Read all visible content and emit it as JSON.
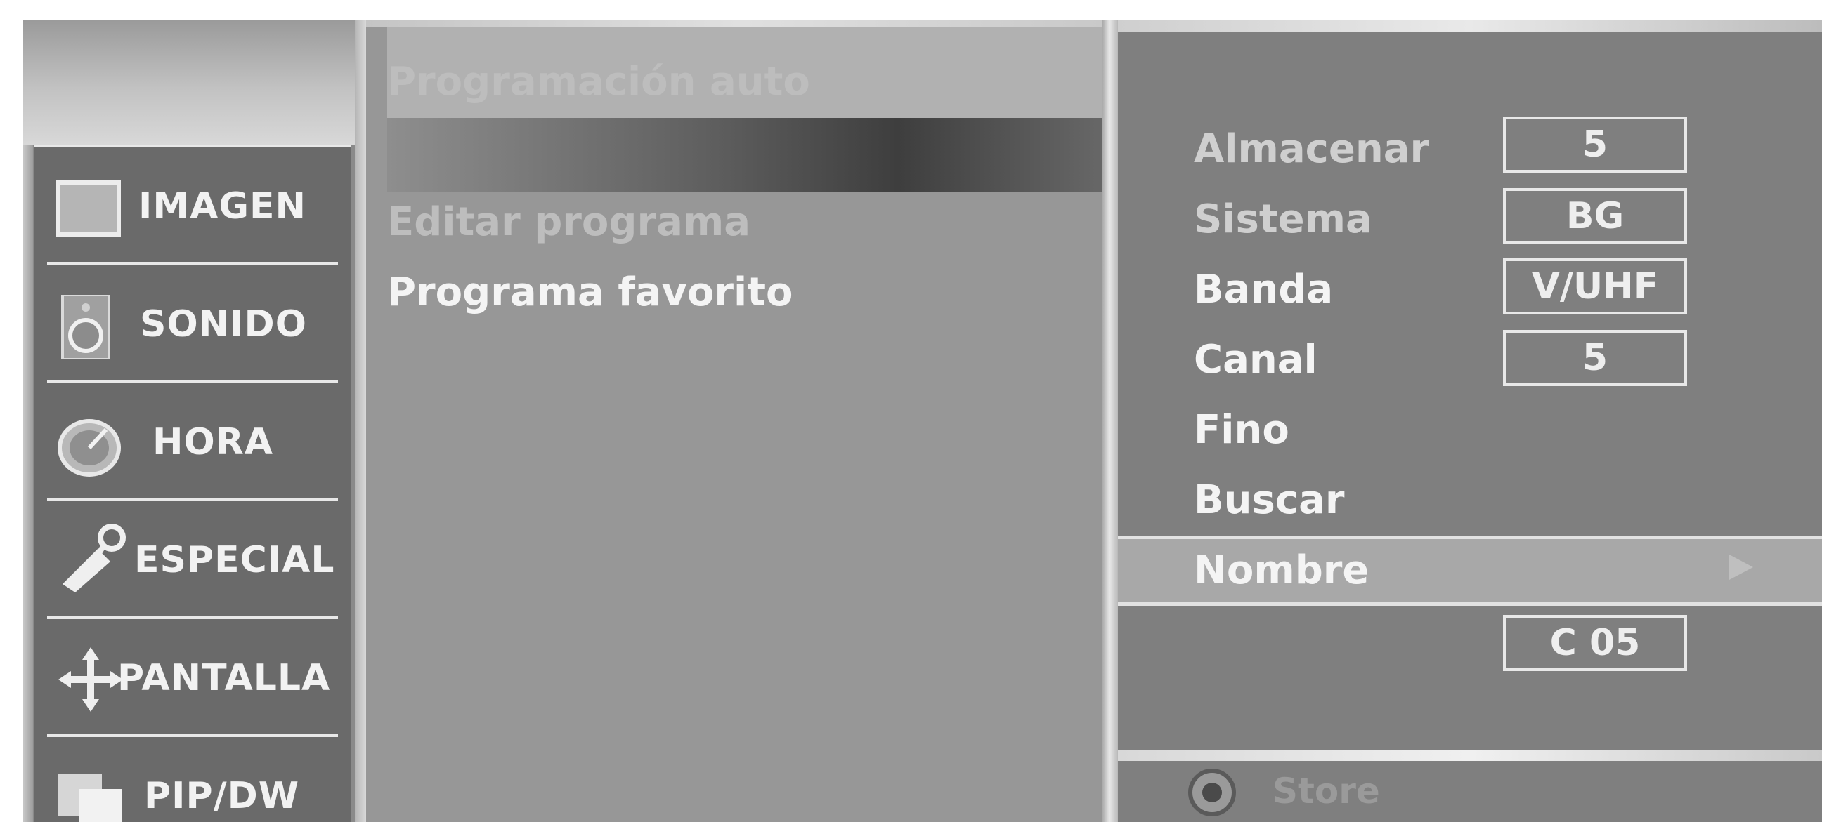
{
  "left_menu": {
    "items": [
      {
        "label": "IMAGEN",
        "icon": "picture-icon"
      },
      {
        "label": "SONIDO",
        "icon": "speaker-icon"
      },
      {
        "label": "HORA",
        "icon": "clock-icon"
      },
      {
        "label": "ESPECIAL",
        "icon": "tag-icon"
      },
      {
        "label": "PANTALLA",
        "icon": "move-arrows-icon"
      },
      {
        "label": "PIP/DW",
        "icon": "pip-icon"
      }
    ]
  },
  "middle_menu": {
    "items": [
      {
        "label": "Programación auto"
      },
      {
        "label": "Editar programa"
      },
      {
        "label": "Programa favorito"
      }
    ]
  },
  "settings": {
    "rows": [
      {
        "label": "Almacenar",
        "value": "5"
      },
      {
        "label": "Sistema",
        "value": "BG"
      },
      {
        "label": "Banda",
        "value": "V/UHF"
      },
      {
        "label": "Canal",
        "value": "5"
      },
      {
        "label": "Fino"
      },
      {
        "label": "Buscar"
      },
      {
        "label": "Nombre",
        "value": "C 05",
        "selected": true
      }
    ]
  },
  "footer": {
    "store_label": "Store",
    "store_icon": "ok-button-icon"
  },
  "colors": {
    "panel": "#8a8a8a",
    "menu_bg": "#6a6a6a",
    "text": "#f4f4f4"
  }
}
